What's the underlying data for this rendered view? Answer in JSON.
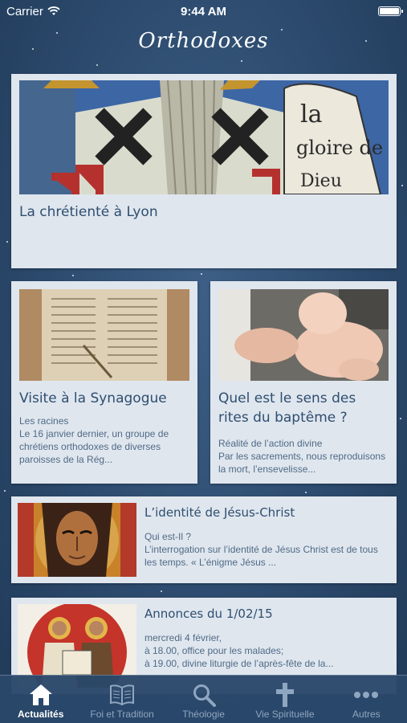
{
  "status_bar": {
    "carrier": "Carrier",
    "time": "9:44 AM"
  },
  "nav": {
    "title": "Orthodoxes"
  },
  "hero": {
    "title": "La chrétienté à Lyon",
    "image_text": [
      "la",
      "gloire de",
      "Dieu"
    ]
  },
  "articles": [
    {
      "title": "Visite à la Synagogue",
      "category": "Les racines",
      "excerpt": "Le 16 janvier dernier, un groupe de chrétiens orthodoxes de diverses paroisses de la Rég..."
    },
    {
      "title": "Quel est le sens des rites du baptême ?",
      "category": "Réalité de l’action divine",
      "excerpt": "Par les sacrements, nous reproduisons la mort, l’ensevelisse..."
    },
    {
      "title": "L’identité de Jésus-Christ",
      "category": "Qui est-Il ?",
      "excerpt": "L’interrogation sur l’identité de Jésus Christ est de tous les temps. « L’énigme Jésus ..."
    },
    {
      "title": "Annonces du 1/02/15",
      "lines": [
        "mercredi 4 février,",
        "à 18.00, office pour les malades;",
        "à 19.00, divine liturgie de l’après-fête de la..."
      ]
    }
  ],
  "tabs": [
    {
      "label": "Actualités",
      "icon": "home-icon",
      "active": true
    },
    {
      "label": "Foi et Tradition",
      "icon": "book-icon"
    },
    {
      "label": "Théologie",
      "icon": "search-icon"
    },
    {
      "label": "Vie Spirituelle",
      "icon": "cross-icon"
    },
    {
      "label": "Autres",
      "icon": "more-icon"
    }
  ],
  "colors": {
    "background": "#2c4a6d",
    "card": "#dfe6ee",
    "title": "#2f4e70",
    "tab_active": "#ffffff",
    "tab_inactive": "#8fa6c0"
  }
}
